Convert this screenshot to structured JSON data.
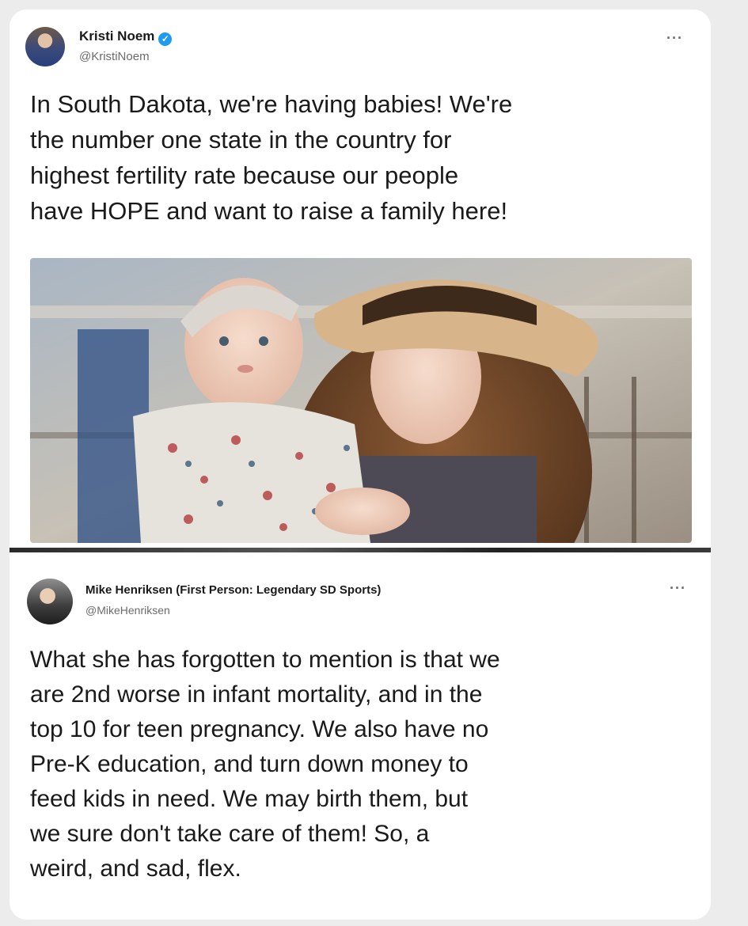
{
  "tweets": [
    {
      "display_name": "Kristi Noem",
      "handle": "@KristiNoem",
      "verified": true,
      "more_label": "···",
      "text": "In South Dakota, we're having babies! We're\nthe number one state in the country for\nhighest fertility rate because our people\nhave HOPE and want to raise a family here!",
      "has_photo": true
    },
    {
      "display_name": "Mike Henriksen (First Person: Legendary SD Sports)",
      "handle": "@MikeHenriksen",
      "verified": false,
      "more_label": "···",
      "text": "What she has forgotten to mention is that we\nare 2nd worse in infant mortality, and in the\ntop 10 for teen pregnancy. We also have no\nPre-K education, and turn down money to\nfeed kids in need. We may birth them, but\nwe sure don't take care of them! So, a\nweird, and sad, flex."
    }
  ],
  "colors": {
    "verified_badge": "#1d9bf0",
    "handle_text": "#6b6b6b",
    "body_text": "#1a1a1a"
  },
  "icons": [
    "verified-check-icon",
    "more-options-icon"
  ]
}
